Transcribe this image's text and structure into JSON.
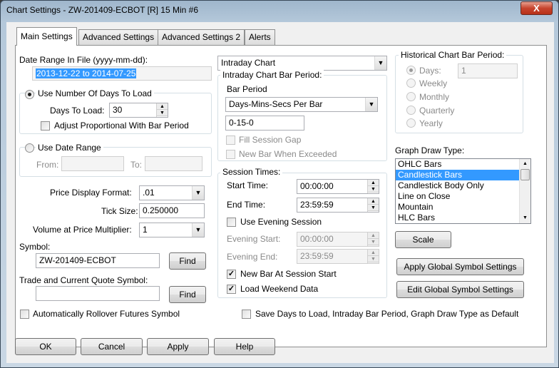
{
  "window": {
    "title": "Chart Settings - ZW-201409-ECBOT [R]  15 Min   #6",
    "close_label": "X"
  },
  "tabs": [
    "Main Settings",
    "Advanced Settings",
    "Advanced Settings 2",
    "Alerts"
  ],
  "date_range": {
    "label": "Date Range In File (yyyy-mm-dd):",
    "value": "2013-12-22 to 2014-07-25"
  },
  "days_group": {
    "radio_label": "Use Number Of Days To Load",
    "days_label": "Days To Load:",
    "days_value": "30",
    "adjust_label": "Adjust Proportional With Bar Period"
  },
  "date_group": {
    "radio_label": "Use Date Range",
    "from_label": "From:",
    "to_label": "To:"
  },
  "price_format": {
    "label": "Price Display Format:",
    "value": ".01"
  },
  "tick_size": {
    "label": "Tick Size:",
    "value": "0.250000"
  },
  "volume_mult": {
    "label": "Volume at Price Multiplier:",
    "value": "1"
  },
  "symbol": {
    "label": "Symbol:",
    "value": "ZW-201409-ECBOT",
    "find_label": "Find"
  },
  "trade_symbol": {
    "label": "Trade and Current Quote Symbol:",
    "value": "",
    "find_label": "Find"
  },
  "rollover_label": "Automatically Rollover Futures Symbol",
  "chart_type": {
    "value": "Intraday Chart"
  },
  "intraday": {
    "group_label": "Intraday Chart Bar Period:",
    "bar_period_label": "Bar Period",
    "bar_period_value": "Days-Mins-Secs Per Bar",
    "period_value": "0-15-0",
    "fill_gap_label": "Fill Session Gap",
    "new_bar_label": "New Bar When Exceeded"
  },
  "session": {
    "group_label": "Session Times:",
    "start_label": "Start Time:",
    "start_value": "00:00:00",
    "end_label": "End Time:",
    "end_value": "23:59:59",
    "use_evening_label": "Use Evening Session",
    "evening_start_label": "Evening Start:",
    "evening_start_value": "00:00:00",
    "evening_end_label": "Evening End:",
    "evening_end_value": "23:59:59",
    "new_bar_session_label": "New Bar At Session Start",
    "weekend_label": "Load Weekend Data"
  },
  "historical": {
    "group_label": "Historical Chart Bar Period:",
    "days_label": "Days:",
    "days_value": "1",
    "weekly_label": "Weekly",
    "monthly_label": "Monthly",
    "quarterly_label": "Quarterly",
    "yearly_label": "Yearly"
  },
  "draw_type": {
    "label": "Graph Draw Type:",
    "items": [
      "OHLC Bars",
      "Candlestick Bars",
      "Candlestick Body Only",
      "Line on Close",
      "Mountain",
      "HLC Bars"
    ],
    "selected": "Candlestick Bars"
  },
  "scale_label": "Scale",
  "apply_global_label": "Apply Global Symbol Settings",
  "edit_global_label": "Edit Global Symbol Settings",
  "save_default_label": "Save Days to Load, Intraday Bar Period, Graph Draw Type as Default",
  "footer": {
    "ok": "OK",
    "cancel": "Cancel",
    "apply": "Apply",
    "help": "Help"
  }
}
